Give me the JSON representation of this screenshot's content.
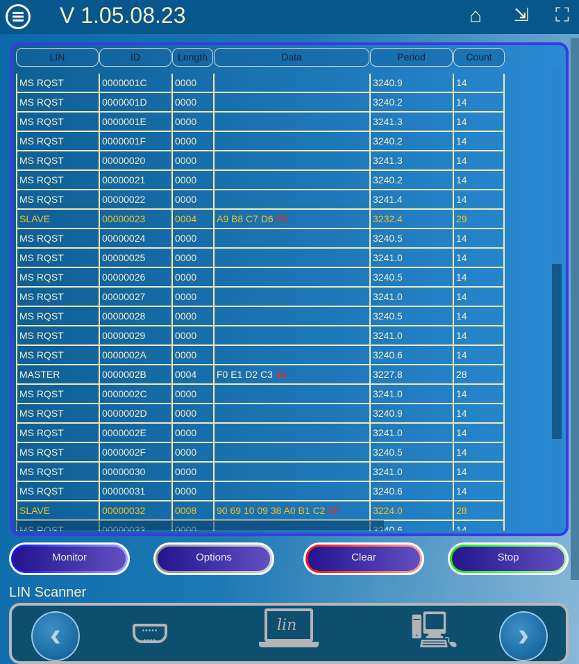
{
  "header": {
    "title": "V 1.05.08.23",
    "icons": [
      "menu-icon",
      "home-icon",
      "restore-window-icon",
      "fullscreen-icon"
    ]
  },
  "table": {
    "columns": [
      "LIN",
      "ID",
      "Length",
      "Data",
      "Period",
      "Count"
    ],
    "rows": [
      {
        "lin": "MS RQST",
        "id": "0000001C",
        "len": "0000",
        "data": "",
        "crc": "",
        "period": "3240.9",
        "count": "14",
        "type": "ms"
      },
      {
        "lin": "MS RQST",
        "id": "0000001D",
        "len": "0000",
        "data": "",
        "crc": "",
        "period": "3240.2",
        "count": "14",
        "type": "ms"
      },
      {
        "lin": "MS RQST",
        "id": "0000001E",
        "len": "0000",
        "data": "",
        "crc": "",
        "period": "3241.3",
        "count": "14",
        "type": "ms"
      },
      {
        "lin": "MS RQST",
        "id": "0000001F",
        "len": "0000",
        "data": "",
        "crc": "",
        "period": "3240.2",
        "count": "14",
        "type": "ms"
      },
      {
        "lin": "MS RQST",
        "id": "00000020",
        "len": "0000",
        "data": "",
        "crc": "",
        "period": "3241.3",
        "count": "14",
        "type": "ms"
      },
      {
        "lin": "MS RQST",
        "id": "00000021",
        "len": "0000",
        "data": "",
        "crc": "",
        "period": "3240.2",
        "count": "14",
        "type": "ms"
      },
      {
        "lin": "MS RQST",
        "id": "00000022",
        "len": "0000",
        "data": "",
        "crc": "",
        "period": "3241.4",
        "count": "14",
        "type": "ms"
      },
      {
        "lin": "SLAVE",
        "id": "00000023",
        "len": "0004",
        "data": "A9 B8 C7 D6",
        "crc": "FE",
        "period": "3232.4",
        "count": "29",
        "type": "sl"
      },
      {
        "lin": "MS RQST",
        "id": "00000024",
        "len": "0000",
        "data": "",
        "crc": "",
        "period": "3240.5",
        "count": "14",
        "type": "ms"
      },
      {
        "lin": "MS RQST",
        "id": "00000025",
        "len": "0000",
        "data": "",
        "crc": "",
        "period": "3241.0",
        "count": "14",
        "type": "ms"
      },
      {
        "lin": "MS RQST",
        "id": "00000026",
        "len": "0000",
        "data": "",
        "crc": "",
        "period": "3240.5",
        "count": "14",
        "type": "ms"
      },
      {
        "lin": "MS RQST",
        "id": "00000027",
        "len": "0000",
        "data": "",
        "crc": "",
        "period": "3241.0",
        "count": "14",
        "type": "ms"
      },
      {
        "lin": "MS RQST",
        "id": "00000028",
        "len": "0000",
        "data": "",
        "crc": "",
        "period": "3240.5",
        "count": "14",
        "type": "ms"
      },
      {
        "lin": "MS RQST",
        "id": "00000029",
        "len": "0000",
        "data": "",
        "crc": "",
        "period": "3241.0",
        "count": "14",
        "type": "ms"
      },
      {
        "lin": "MS RQST",
        "id": "0000002A",
        "len": "0000",
        "data": "",
        "crc": "",
        "period": "3240.6",
        "count": "14",
        "type": "ms"
      },
      {
        "lin": "MASTER",
        "id": "0000002B",
        "len": "0004",
        "data": "F0 E1 D2 C3",
        "crc": "96",
        "period": "3227.8",
        "count": "28",
        "type": "ma"
      },
      {
        "lin": "MS RQST",
        "id": "0000002C",
        "len": "0000",
        "data": "",
        "crc": "",
        "period": "3241.0",
        "count": "14",
        "type": "ms"
      },
      {
        "lin": "MS RQST",
        "id": "0000002D",
        "len": "0000",
        "data": "",
        "crc": "",
        "period": "3240.9",
        "count": "14",
        "type": "ms"
      },
      {
        "lin": "MS RQST",
        "id": "0000002E",
        "len": "0000",
        "data": "",
        "crc": "",
        "period": "3241.0",
        "count": "14",
        "type": "ms"
      },
      {
        "lin": "MS RQST",
        "id": "0000002F",
        "len": "0000",
        "data": "",
        "crc": "",
        "period": "3240.5",
        "count": "14",
        "type": "ms"
      },
      {
        "lin": "MS RQST",
        "id": "00000030",
        "len": "0000",
        "data": "",
        "crc": "",
        "period": "3241.0",
        "count": "14",
        "type": "ms"
      },
      {
        "lin": "MS RQST",
        "id": "00000031",
        "len": "0000",
        "data": "",
        "crc": "",
        "period": "3240.6",
        "count": "14",
        "type": "ms"
      },
      {
        "lin": "SLAVE",
        "id": "00000032",
        "len": "0008",
        "data": "90 69 10 09 38 A0 B1 C2",
        "crc": "9F",
        "period": "3224.0",
        "count": "28",
        "type": "sl"
      },
      {
        "lin": "MS RQST",
        "id": "00000033",
        "len": "0000",
        "data": "",
        "crc": "",
        "period": "3240.6",
        "count": "14",
        "type": "ms"
      }
    ],
    "colors": {
      "slave": "#f0c22a",
      "checksum": "#ff2020",
      "grid": "#f1e9b8",
      "frame": "#3a3ae6"
    }
  },
  "buttons": [
    {
      "label": "Monitor",
      "ring": "#2020ff"
    },
    {
      "label": "Options",
      "ring": "#a0a0a0"
    },
    {
      "label": "Clear",
      "ring": "#ff2020"
    },
    {
      "label": "Stop",
      "ring": "#20ee20"
    }
  ],
  "footer": {
    "section_title": "LIN Scanner",
    "lin_logo": "lin",
    "icons": [
      "previous-arrow-icon",
      "serial-port-icon",
      "lin-laptop-icon",
      "pc-sync-icon",
      "next-arrow-icon"
    ]
  }
}
